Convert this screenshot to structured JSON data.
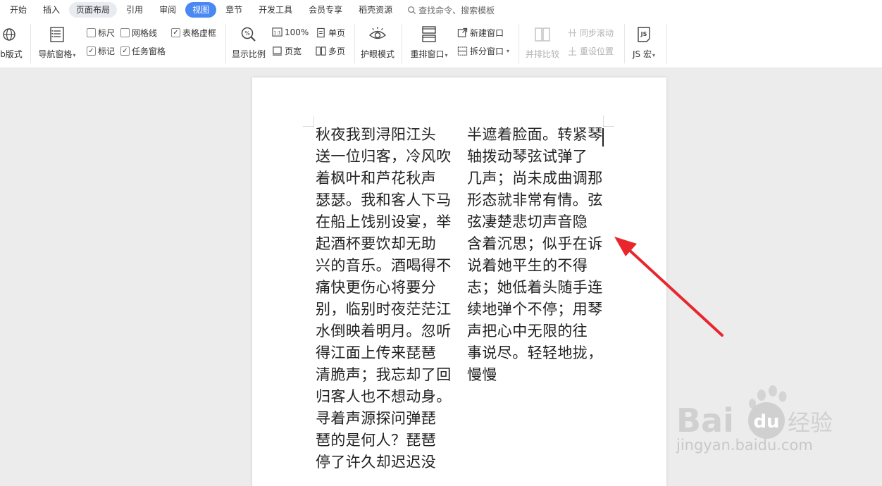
{
  "menu": {
    "tabs": [
      "开始",
      "插入",
      "页面布局",
      "引用",
      "审阅",
      "视图",
      "章节",
      "开发工具",
      "会员专享",
      "稻壳资源"
    ],
    "search_label": "查找命令、搜索模板"
  },
  "ribbon": {
    "web_layout": "b版式",
    "nav_pane": "导航窗格",
    "ruler": "标尺",
    "gridlines": "网格线",
    "table_border": "表格虚框",
    "mark": "标记",
    "task_pane": "任务窗格",
    "zoom": "显示比例",
    "zoom_100": "100%",
    "single_page": "单页",
    "page_width": "页宽",
    "multi_page": "多页",
    "eye_mode": "护眼模式",
    "rearrange": "重排窗口",
    "new_window": "新建窗口",
    "split_window": "拆分窗口",
    "side_by_side": "并排比较",
    "sync_scroll": "同步滚动",
    "reset_position": "重设位置",
    "js_macro": "JS 宏"
  },
  "document": {
    "column1": [
      "秋夜我到浔阳江头",
      "送一位归客，冷风吹",
      "着枫叶和芦花秋声",
      "瑟瑟。我和客人下马",
      "在船上饯别设宴，举",
      "起酒杯要饮却无助",
      "兴的音乐。酒喝得不",
      "痛快更伤心将要分",
      "别，临别时夜茫茫江",
      "水倒映着明月。忽听",
      "得江面上传来琵琶",
      "清脆声；我忘却了回",
      "归客人也不想动身。",
      "寻着声源探问弹琵",
      "琶的是何人？琵琶",
      "停了许久却迟迟没"
    ],
    "column2": [
      "半遮着脸面。转紧琴",
      "轴拨动琴弦试弹了",
      "几声；尚未成曲调那",
      "形态就非常有情。弦",
      "弦凄楚悲切声音隐",
      "含着沉思；似乎在诉",
      "说着她平生的不得",
      "志；她低着头随手连",
      "续地弹个不停；用琴",
      "声把心中无限的往",
      "事说尽。轻轻地拢，",
      "慢慢"
    ]
  },
  "watermark": {
    "brand": "Bai",
    "brand2": "du",
    "brand3": "经验",
    "url": "jingyan.baidu.com"
  },
  "colors": {
    "accent": "#4a88f3",
    "arrow": "#e8262d"
  }
}
